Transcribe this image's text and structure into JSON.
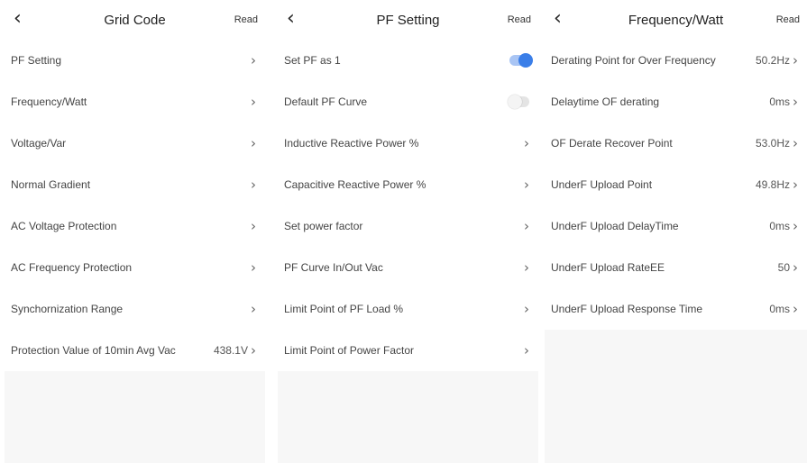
{
  "colors": {
    "accent": "#3a7ee8",
    "panel_bg": "#f7f7f7"
  },
  "icons": {
    "back": "chevron-left-icon",
    "row_arrow": "chevron-right-icon"
  },
  "panel1": {
    "title": "Grid Code",
    "read_label": "Read",
    "items": [
      {
        "label": "PF Setting",
        "value": ""
      },
      {
        "label": "Frequency/Watt",
        "value": ""
      },
      {
        "label": "Voltage/Var",
        "value": ""
      },
      {
        "label": "Normal Gradient",
        "value": ""
      },
      {
        "label": "AC Voltage Protection",
        "value": ""
      },
      {
        "label": "AC Frequency Protection",
        "value": ""
      },
      {
        "label": "Synchornization Range",
        "value": ""
      },
      {
        "label": "Protection Value of 10min Avg Vac",
        "value": "438.1V"
      }
    ]
  },
  "panel2": {
    "title": "PF Setting",
    "read_label": "Read",
    "toggles": [
      {
        "label": "Set PF as 1",
        "on": true
      },
      {
        "label": "Default PF Curve",
        "on": false
      }
    ],
    "items": [
      {
        "label": "Inductive Reactive Power %"
      },
      {
        "label": "Capacitive Reactive Power %"
      },
      {
        "label": "Set power factor"
      },
      {
        "label": "PF Curve In/Out Vac"
      },
      {
        "label": "Limit Point of PF Load %"
      },
      {
        "label": "Limit Point of Power Factor"
      }
    ]
  },
  "panel3": {
    "title": "Frequency/Watt",
    "read_label": "Read",
    "items": [
      {
        "label": "Derating Point for Over Frequency",
        "value": "50.2Hz"
      },
      {
        "label": "Delaytime OF derating",
        "value": "0ms"
      },
      {
        "label": "OF Derate Recover Point",
        "value": "53.0Hz"
      },
      {
        "label": "UnderF Upload Point",
        "value": "49.8Hz"
      },
      {
        "label": "UnderF Upload DelayTime",
        "value": "0ms"
      },
      {
        "label": "UnderF Upload RateEE",
        "value": "50"
      },
      {
        "label": "UnderF Upload Response Time",
        "value": "0ms"
      }
    ]
  }
}
